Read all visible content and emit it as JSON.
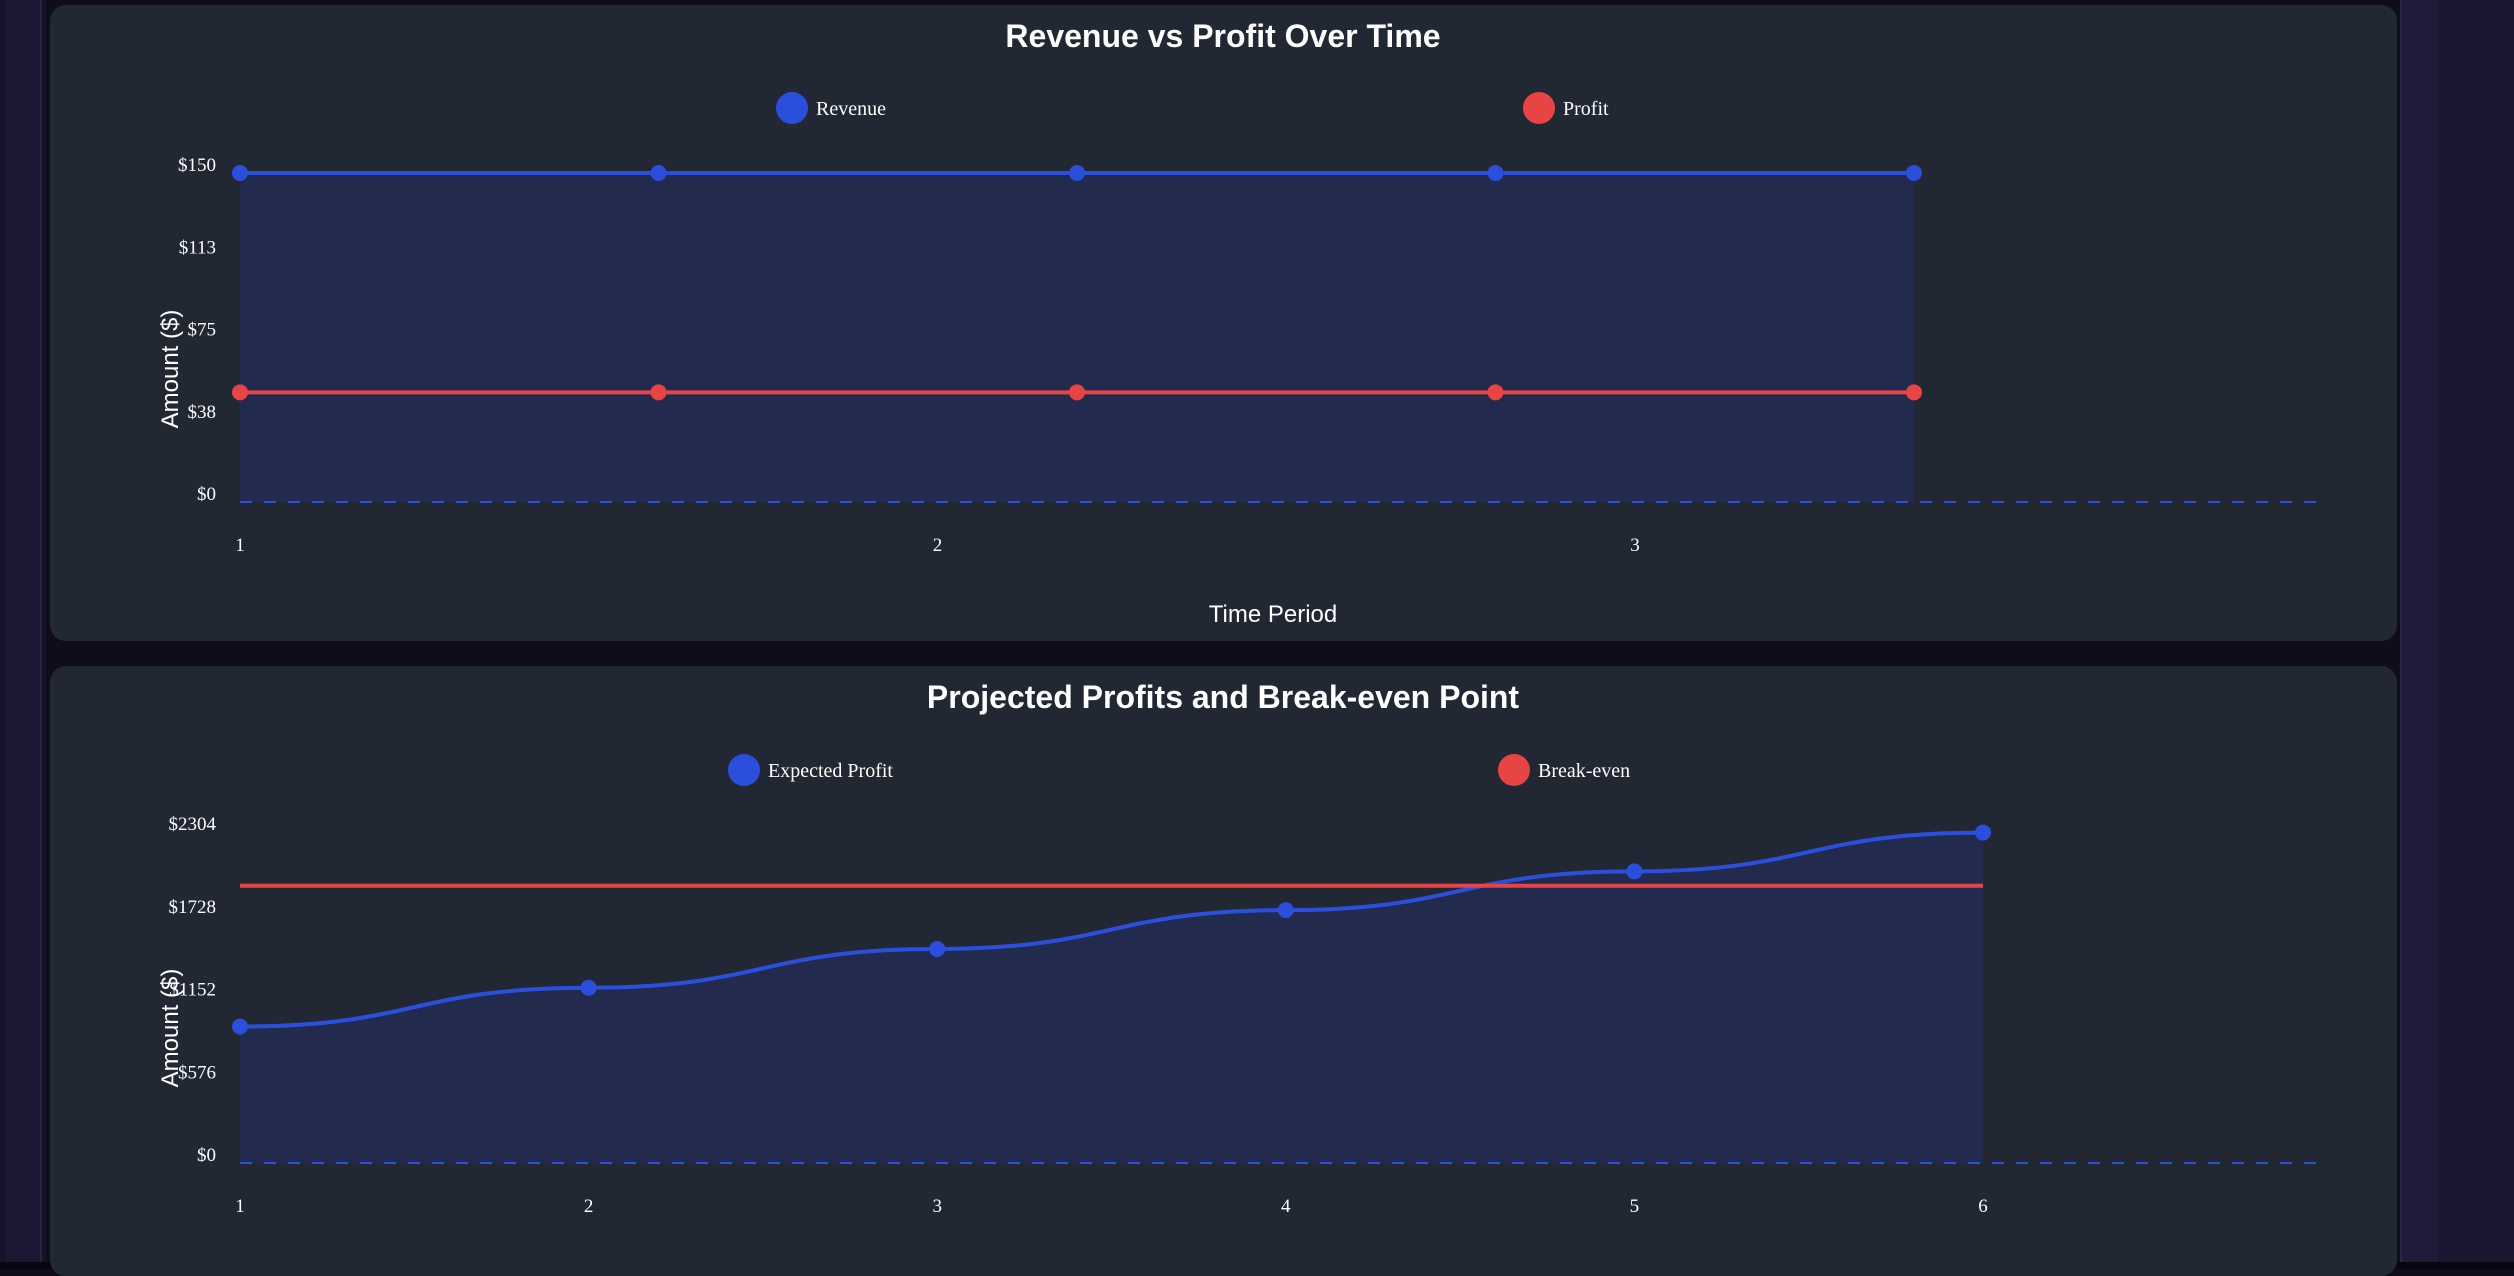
{
  "colors": {
    "revenue": "#2b4fdc",
    "profit": "#e84444",
    "area_fill": "#222a4d",
    "card_bg": "#222833",
    "page_bg": "#0f0c1b"
  },
  "chart_data": [
    {
      "type": "line",
      "title": "Revenue vs Profit Over Time",
      "xlabel": "Time Period",
      "ylabel": "Amount ($)",
      "ylim": [
        0,
        150
      ],
      "y_ticks": [
        "$0",
        "$38",
        "$75",
        "$113",
        "$150"
      ],
      "x_ticks": [
        "1",
        "2",
        "3"
      ],
      "legend_placement": "top",
      "grid": false,
      "series": [
        {
          "name": "Revenue",
          "values": [
            150,
            150,
            150,
            150,
            150
          ],
          "color": "#2b4fdc",
          "fill": true
        },
        {
          "name": "Profit",
          "values": [
            50,
            50,
            50,
            50,
            50
          ],
          "color": "#e84444",
          "fill": false
        }
      ]
    },
    {
      "type": "line",
      "title": "Projected Profits and Break-even Point",
      "xlabel": "",
      "ylabel": "Amount ($)",
      "ylim": [
        0,
        2304
      ],
      "y_ticks": [
        "$0",
        "$576",
        "$1152",
        "$1728",
        "$2304"
      ],
      "x_ticks": [
        "1",
        "2",
        "3",
        "4",
        "5",
        "6"
      ],
      "legend_placement": "top",
      "grid": false,
      "series": [
        {
          "name": "Expected Profit",
          "values": [
            950,
            1220,
            1490,
            1760,
            2030,
            2300
          ],
          "color": "#2b4fdc",
          "fill": true,
          "smooth": true
        },
        {
          "name": "Break-even",
          "values": [
            1930,
            1930,
            1930,
            1930,
            1930,
            1930
          ],
          "color": "#e84444",
          "fill": false,
          "markers": false
        }
      ]
    }
  ]
}
